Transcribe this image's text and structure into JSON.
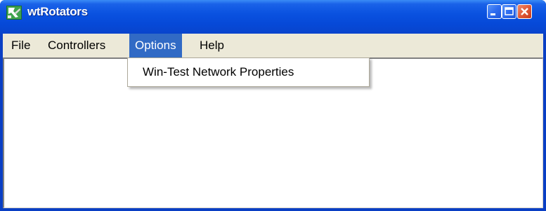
{
  "window": {
    "title": "wtRotators",
    "app_icon": "wtrotators-app-icon",
    "controls": {
      "minimize_icon": "minimize-icon",
      "maximize_icon": "maximize-icon",
      "close_icon": "close-icon"
    }
  },
  "menubar": {
    "items": [
      {
        "label": "File"
      },
      {
        "label": "Controllers"
      },
      {
        "label": "Options",
        "active": true
      },
      {
        "label": "Help"
      }
    ]
  },
  "dropdown": {
    "items": [
      {
        "label": "Win-Test Network Properties"
      }
    ]
  },
  "colors": {
    "titlebar": "#0a52e0",
    "menu_highlight": "#316ac5",
    "menubar_bg": "#ece9d8",
    "close_button": "#e05a38"
  }
}
